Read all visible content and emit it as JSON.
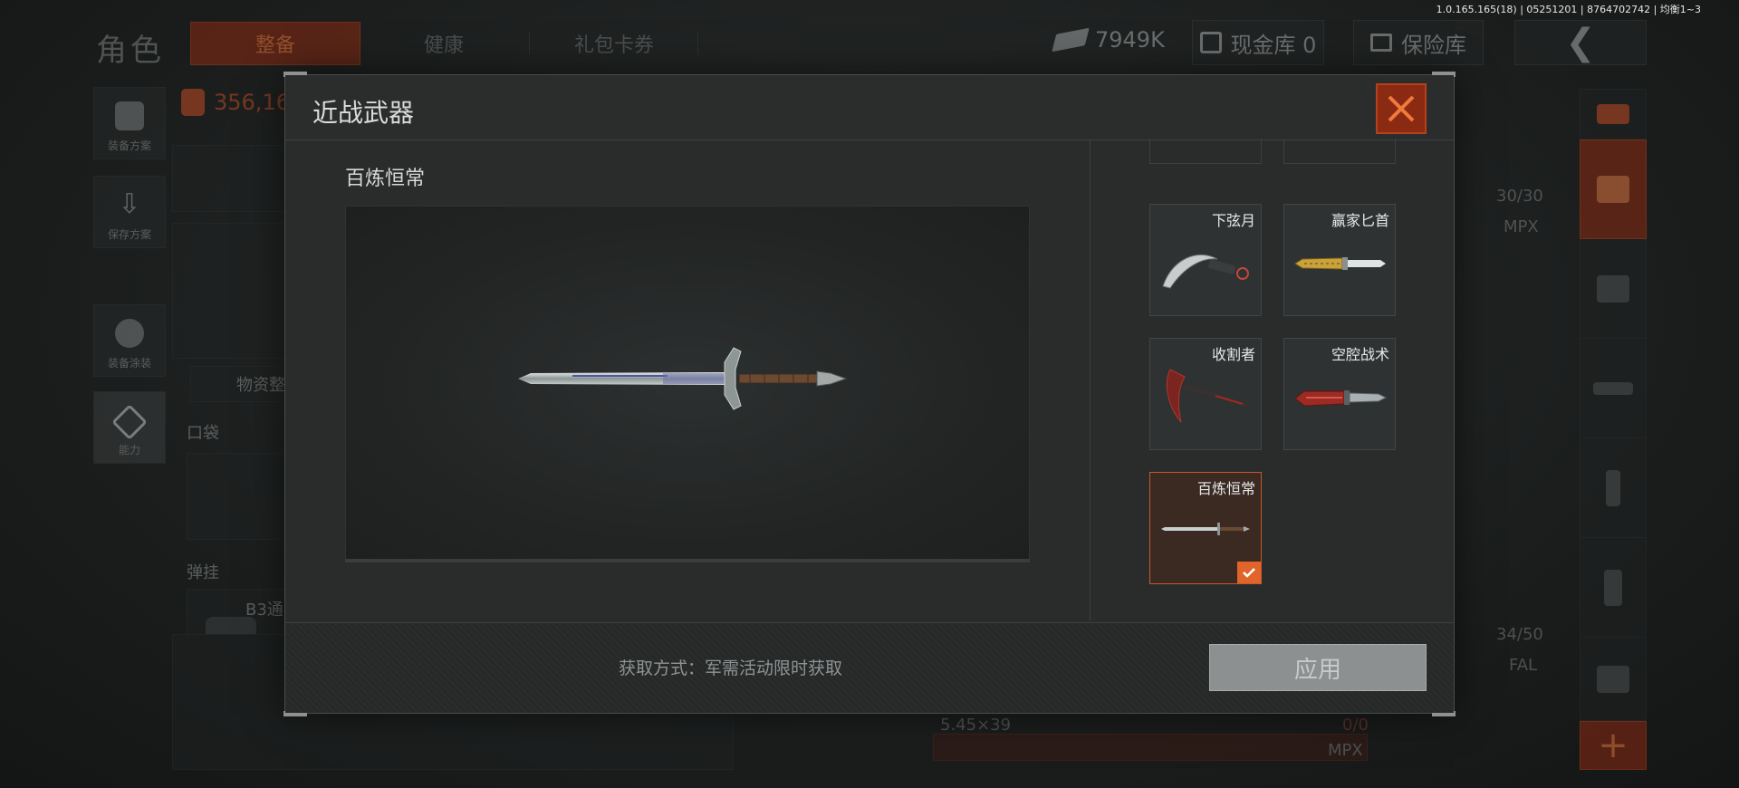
{
  "version_text": "1.0.165.165(18) | 05251201 | 8764702742 | 均衡1~3",
  "header": {
    "title": "角色",
    "tabs": [
      "整备",
      "健康",
      "礼包卡券"
    ],
    "cash": "7949K",
    "cash_box": "现金库 0",
    "vault": "保险库"
  },
  "sidebar": {
    "items": [
      "装备方案",
      "保存方案",
      "装备涂装",
      "能力"
    ]
  },
  "background": {
    "bag_value": "356,16",
    "supplies_label": "物资整",
    "pocket_label": "口袋",
    "rig_label": "弹挂",
    "rig_name": "B3通",
    "ammo": {
      "mag1_count": "30/30",
      "mag1_weapon": "MPX",
      "mag2_count": "34/50",
      "mag2_weapon": "FAL",
      "caliber": "5.45×39",
      "mag3_count": "0/0",
      "mag3_weapon": "MPX"
    }
  },
  "modal": {
    "title": "近战武器",
    "preview_name": "百炼恒常",
    "weapons": [
      {
        "name": "下弦月",
        "selected": false
      },
      {
        "name": "赢家匕首",
        "selected": false
      },
      {
        "name": "收割者",
        "selected": false
      },
      {
        "name": "空腔战术",
        "selected": false
      },
      {
        "name": "百炼恒常",
        "selected": true
      }
    ],
    "acquire_text": "获取方式：军需活动限时获取",
    "apply_label": "应用"
  },
  "colors": {
    "accent": "#e1652a",
    "accent_dark": "#8a2a12"
  }
}
